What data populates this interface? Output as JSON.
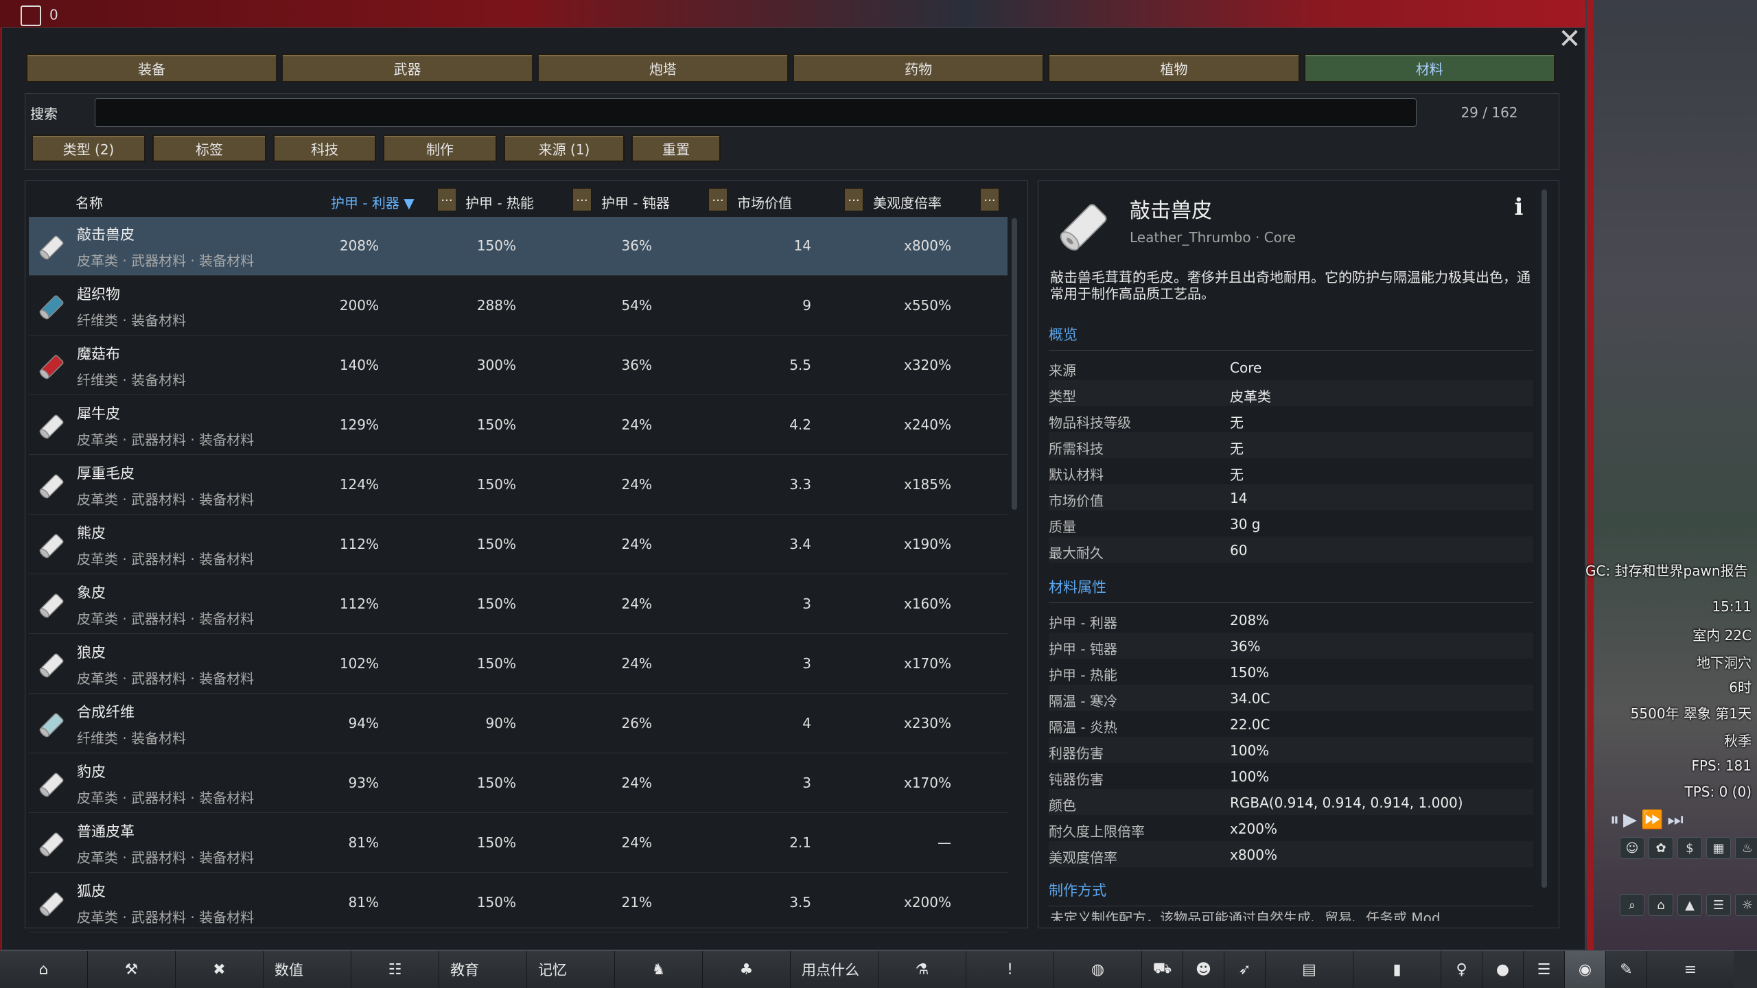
{
  "top": {
    "counter": "0"
  },
  "window": {
    "close_glyph": "✕"
  },
  "tabs": [
    {
      "label": "装备",
      "active": false
    },
    {
      "label": "武器",
      "active": false
    },
    {
      "label": "炮塔",
      "active": false
    },
    {
      "label": "药物",
      "active": false
    },
    {
      "label": "植物",
      "active": false
    },
    {
      "label": "材料",
      "active": true
    }
  ],
  "search": {
    "label": "搜索",
    "value": "",
    "placeholder": "",
    "count": "29 / 162"
  },
  "filters": [
    {
      "label": "类型 (2)"
    },
    {
      "label": "标签"
    },
    {
      "label": "科技"
    },
    {
      "label": "制作"
    },
    {
      "label": "来源 (1)"
    },
    {
      "label": "重置"
    }
  ],
  "table": {
    "columns": {
      "name": "名称",
      "sharp": "护甲 - 利器 ▼",
      "heat": "护甲 - 热能",
      "blunt": "护甲 - 钝器",
      "market": "市场价值",
      "beauty": "美观度倍率",
      "dots": "..."
    },
    "rows": [
      {
        "name": "敲击兽皮",
        "tags": "皮革类 · 武器材料 · 装备材料",
        "sharp": "208%",
        "heat": "150%",
        "blunt": "36%",
        "market": "14",
        "beauty": "x800%",
        "icon": "white-roll",
        "color": "#e8e8e8",
        "selected": true
      },
      {
        "name": "超织物",
        "tags": "纤维类 · 装备材料",
        "sharp": "200%",
        "heat": "288%",
        "blunt": "54%",
        "market": "9",
        "beauty": "x550%",
        "icon": "teal-roll",
        "color": "#3e8fae",
        "selected": false
      },
      {
        "name": "魔菇布",
        "tags": "纤维类 · 装备材料",
        "sharp": "140%",
        "heat": "300%",
        "blunt": "36%",
        "market": "5.5",
        "beauty": "x320%",
        "icon": "red-roll",
        "color": "#c0282e",
        "selected": false
      },
      {
        "name": "犀牛皮",
        "tags": "皮革类 · 武器材料 · 装备材料",
        "sharp": "129%",
        "heat": "150%",
        "blunt": "24%",
        "market": "4.2",
        "beauty": "x240%",
        "icon": "white-roll",
        "color": "#e8e8e8",
        "selected": false
      },
      {
        "name": "厚重毛皮",
        "tags": "皮革类 · 武器材料 · 装备材料",
        "sharp": "124%",
        "heat": "150%",
        "blunt": "24%",
        "market": "3.3",
        "beauty": "x185%",
        "icon": "white-roll",
        "color": "#e8e8e8",
        "selected": false
      },
      {
        "name": "熊皮",
        "tags": "皮革类 · 武器材料 · 装备材料",
        "sharp": "112%",
        "heat": "150%",
        "blunt": "24%",
        "market": "3.4",
        "beauty": "x190%",
        "icon": "white-roll",
        "color": "#e8e8e8",
        "selected": false
      },
      {
        "name": "象皮",
        "tags": "皮革类 · 武器材料 · 装备材料",
        "sharp": "112%",
        "heat": "150%",
        "blunt": "24%",
        "market": "3",
        "beauty": "x160%",
        "icon": "white-roll",
        "color": "#e8e8e8",
        "selected": false
      },
      {
        "name": "狼皮",
        "tags": "皮革类 · 武器材料 · 装备材料",
        "sharp": "102%",
        "heat": "150%",
        "blunt": "24%",
        "market": "3",
        "beauty": "x170%",
        "icon": "white-roll",
        "color": "#e8e8e8",
        "selected": false
      },
      {
        "name": "合成纤维",
        "tags": "纤维类 · 装备材料",
        "sharp": "94%",
        "heat": "90%",
        "blunt": "26%",
        "market": "4",
        "beauty": "x230%",
        "icon": "pale-blue-roll",
        "color": "#a6cfd6",
        "selected": false
      },
      {
        "name": "豹皮",
        "tags": "皮革类 · 武器材料 · 装备材料",
        "sharp": "93%",
        "heat": "150%",
        "blunt": "24%",
        "market": "3",
        "beauty": "x170%",
        "icon": "white-roll",
        "color": "#e8e8e8",
        "selected": false
      },
      {
        "name": "普通皮革",
        "tags": "皮革类 · 武器材料 · 装备材料",
        "sharp": "81%",
        "heat": "150%",
        "blunt": "24%",
        "market": "2.1",
        "beauty": "—",
        "icon": "white-roll",
        "color": "#e8e8e8",
        "selected": false
      },
      {
        "name": "狐皮",
        "tags": "皮革类 · 武器材料 · 装备材料",
        "sharp": "81%",
        "heat": "150%",
        "blunt": "21%",
        "market": "3.5",
        "beauty": "x200%",
        "icon": "white-roll",
        "color": "#e8e8e8",
        "selected": false
      }
    ]
  },
  "detail": {
    "title": "敲击兽皮",
    "defname": "Leather_Thrumbo",
    "source": "Core",
    "sub_sep": "·",
    "info_glyph": "i",
    "description": "敲击兽毛茸茸的毛皮。奢侈并且出奇地耐用。它的防护与隔温能力极其出色，通常用于制作高品质工艺品。",
    "overview_title": "概览",
    "overview": [
      {
        "k": "来源",
        "v": "Core"
      },
      {
        "k": "类型",
        "v": "皮革类"
      },
      {
        "k": "物品科技等级",
        "v": "无"
      },
      {
        "k": "所需科技",
        "v": "无"
      },
      {
        "k": "默认材料",
        "v": "无"
      },
      {
        "k": "市场价值",
        "v": "14"
      },
      {
        "k": "质量",
        "v": "30 g"
      },
      {
        "k": "最大耐久",
        "v": "60"
      }
    ],
    "material_title": "材料属性",
    "material": [
      {
        "k": "护甲 - 利器",
        "v": "208%"
      },
      {
        "k": "护甲 - 钝器",
        "v": "36%"
      },
      {
        "k": "护甲 - 热能",
        "v": "150%"
      },
      {
        "k": "隔温 - 寒冷",
        "v": "34.0C"
      },
      {
        "k": "隔温 - 炎热",
        "v": "22.0C"
      },
      {
        "k": "利器伤害",
        "v": "100%"
      },
      {
        "k": "钝器伤害",
        "v": "100%"
      },
      {
        "k": "颜色",
        "v": "RGBA(0.914, 0.914, 0.914, 1.000)"
      },
      {
        "k": "耐久度上限倍率",
        "v": "x200%"
      },
      {
        "k": "美观度倍率",
        "v": "x800%"
      }
    ],
    "craft_title": "制作方式",
    "craft_text": "未定义制作配方，该物品可能通过自然生成、贸易、任务或 Mod"
  },
  "hud": {
    "message": "GC: 封存和世界pawn报告",
    "time": "15:11",
    "temp": "室内 22C",
    "location": "地下洞穴",
    "hour": "6时",
    "date": "5500年 翠象 第1天",
    "season": "秋季",
    "fps": "FPS: 181",
    "tps": "TPS: 0 (0)"
  },
  "bottom": {
    "stats": "数值",
    "education": "教育",
    "memory": "记忆",
    "what_to_use": "用点什么"
  }
}
